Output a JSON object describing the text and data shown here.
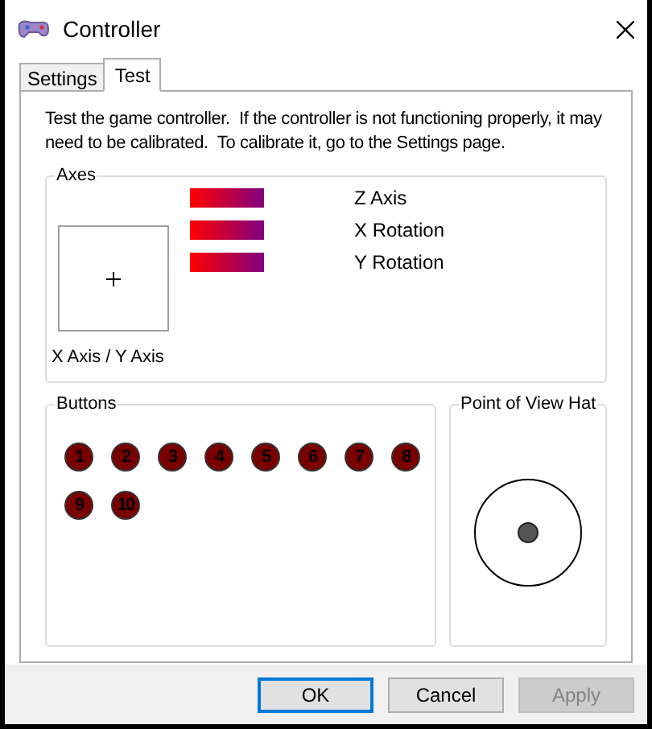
{
  "window": {
    "title": "Controller"
  },
  "tabs": [
    {
      "label": "Settings",
      "selected": false
    },
    {
      "label": "Test",
      "selected": true
    }
  ],
  "description": "Test the game controller.  If the controller is not functioning properly, it may need to be calibrated.  To calibrate it, go to the Settings page.",
  "axes": {
    "title": "Axes",
    "xy_label": "X Axis / Y Axis",
    "bars": [
      {
        "name": "Z Axis",
        "level": 1
      },
      {
        "name": "X Rotation",
        "level": 1
      },
      {
        "name": "Y Rotation",
        "level": 1
      }
    ]
  },
  "buttons_group": {
    "title": "Buttons",
    "buttons": [
      "1",
      "2",
      "3",
      "4",
      "5",
      "6",
      "7",
      "8",
      "9",
      "10"
    ]
  },
  "pov_hat": {
    "title": "Point of View Hat"
  },
  "dialog_buttons": [
    {
      "label": "OK",
      "disabled": false,
      "default": true
    },
    {
      "label": "Cancel",
      "disabled": false,
      "default": false
    },
    {
      "label": "Apply",
      "disabled": true,
      "default": false
    }
  ]
}
